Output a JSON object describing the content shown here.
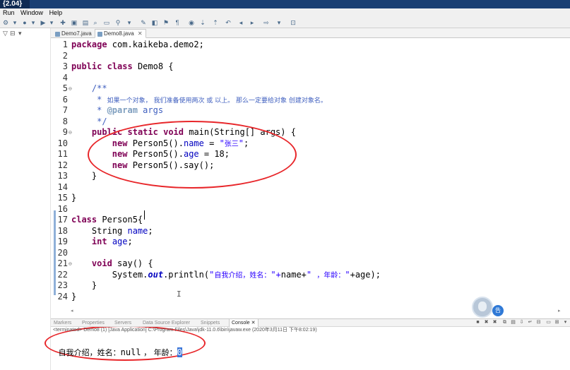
{
  "titlebar": {
    "logo": "{2.04}"
  },
  "menu": {
    "items": [
      "Run",
      "Window",
      "Help"
    ]
  },
  "toolbar": {
    "icons": [
      "gear-icon",
      "debug-icon",
      "run-icon",
      "dropdown-icon",
      "new-icon",
      "save-icon",
      "open-icon",
      "search-icon",
      "pin-icon",
      "bookmark-icon",
      "back-icon",
      "forward-icon"
    ]
  },
  "editor": {
    "tabs": [
      {
        "label": "Demo7.java",
        "active": false
      },
      {
        "label": "Demo8.java",
        "active": true,
        "close": "✕"
      }
    ],
    "lines": [
      {
        "n": "1",
        "fold": "",
        "segs": [
          [
            "kw",
            "package"
          ],
          [
            "t",
            " com.kaikeba.demo2;"
          ]
        ]
      },
      {
        "n": "2",
        "fold": "",
        "segs": []
      },
      {
        "n": "3",
        "fold": "",
        "segs": [
          [
            "kw",
            "public"
          ],
          [
            "t",
            " "
          ],
          [
            "kw",
            "class"
          ],
          [
            "t",
            " Demo8 {"
          ]
        ]
      },
      {
        "n": "4",
        "fold": "",
        "segs": []
      },
      {
        "n": "5",
        "fold": "⊖",
        "segs": [
          [
            "t",
            "    "
          ],
          [
            "cmt",
            "/**"
          ]
        ]
      },
      {
        "n": "6",
        "fold": "",
        "segs": [
          [
            "t",
            "     "
          ],
          [
            "cmt",
            "* "
          ],
          [
            "cn-cmt",
            "如果一个对象， 我们准备使用两次 或 以上。 那么一定要给对象 创建对象名。"
          ]
        ]
      },
      {
        "n": "7",
        "fold": "",
        "segs": [
          [
            "t",
            "     "
          ],
          [
            "cmt",
            "* "
          ],
          [
            "tag",
            "@param"
          ],
          [
            "cmt",
            " args"
          ]
        ]
      },
      {
        "n": "8",
        "fold": "",
        "segs": [
          [
            "t",
            "     "
          ],
          [
            "cmt",
            "*/"
          ]
        ]
      },
      {
        "n": "9",
        "fold": "⊖",
        "segs": [
          [
            "t",
            "    "
          ],
          [
            "kw",
            "public"
          ],
          [
            "t",
            " "
          ],
          [
            "kw",
            "static"
          ],
          [
            "t",
            " "
          ],
          [
            "kw",
            "void"
          ],
          [
            "t",
            " main(String[] args) {"
          ]
        ]
      },
      {
        "n": "10",
        "fold": "",
        "segs": [
          [
            "t",
            "        "
          ],
          [
            "kw",
            "new"
          ],
          [
            "t",
            " Person5()."
          ],
          [
            "fld",
            "name"
          ],
          [
            "t",
            " = "
          ],
          [
            "str",
            "\""
          ],
          [
            "cn-str",
            "张三"
          ],
          [
            "str",
            "\""
          ],
          [
            "t",
            ";"
          ]
        ]
      },
      {
        "n": "11",
        "fold": "",
        "segs": [
          [
            "t",
            "        "
          ],
          [
            "kw",
            "new"
          ],
          [
            "t",
            " Person5()."
          ],
          [
            "fld",
            "age"
          ],
          [
            "t",
            " = 18;"
          ]
        ]
      },
      {
        "n": "12",
        "fold": "",
        "segs": [
          [
            "t",
            "        "
          ],
          [
            "kw",
            "new"
          ],
          [
            "t",
            " Person5().say();"
          ]
        ]
      },
      {
        "n": "13",
        "fold": "",
        "segs": [
          [
            "t",
            "    }"
          ]
        ]
      },
      {
        "n": "14",
        "fold": "",
        "segs": []
      },
      {
        "n": "15",
        "fold": "",
        "segs": [
          [
            "t",
            "}"
          ]
        ]
      },
      {
        "n": "16",
        "fold": "",
        "segs": []
      },
      {
        "n": "17",
        "fold": "",
        "segs": [
          [
            "kw",
            "class"
          ],
          [
            "t",
            " Person5{"
          ]
        ]
      },
      {
        "n": "18",
        "fold": "",
        "segs": [
          [
            "t",
            "    String "
          ],
          [
            "fld",
            "name"
          ],
          [
            "t",
            ";"
          ]
        ]
      },
      {
        "n": "19",
        "fold": "",
        "segs": [
          [
            "t",
            "    "
          ],
          [
            "kw",
            "int"
          ],
          [
            "t",
            " "
          ],
          [
            "fld",
            "age"
          ],
          [
            "t",
            ";"
          ]
        ]
      },
      {
        "n": "20",
        "fold": "",
        "segs": []
      },
      {
        "n": "21",
        "fold": "⊖",
        "segs": [
          [
            "t",
            "    "
          ],
          [
            "kw",
            "void"
          ],
          [
            "t",
            " say() {"
          ]
        ]
      },
      {
        "n": "22",
        "fold": "",
        "segs": [
          [
            "t",
            "        System."
          ],
          [
            "it-fld",
            "out"
          ],
          [
            "t",
            ".println("
          ],
          [
            "str",
            "\""
          ],
          [
            "cn-str",
            "自我介绍，姓名："
          ],
          [
            "str",
            "\"+"
          ],
          [
            "t",
            "name+"
          ],
          [
            "str",
            "\" "
          ],
          [
            "cn-str",
            "，年龄："
          ],
          [
            "str",
            "\""
          ],
          [
            "t",
            "+age);"
          ]
        ]
      },
      {
        "n": "23",
        "fold": "",
        "segs": [
          [
            "t",
            "    }"
          ]
        ]
      },
      {
        "n": "24",
        "fold": "",
        "segs": [
          [
            "t",
            "}"
          ]
        ]
      }
    ]
  },
  "console": {
    "tabs": [
      "Markers",
      "Properties",
      "Servers",
      "Data Source Explorer",
      "Snippets",
      "Console"
    ],
    "active_tab": "Console",
    "close": "✕",
    "terminated": "<terminated> Demo8 (1) [Java Application] C:\\Program Files\\Java\\jdk-11.0.6\\bin\\javaw.exe (2020年3月11日 下午8:02:19)",
    "output_cn1": "自我介绍，姓名：",
    "output_null": "null",
    "output_cn2": " ， 年龄：",
    "output_value": "0"
  },
  "overlay": {
    "badge": "告"
  }
}
